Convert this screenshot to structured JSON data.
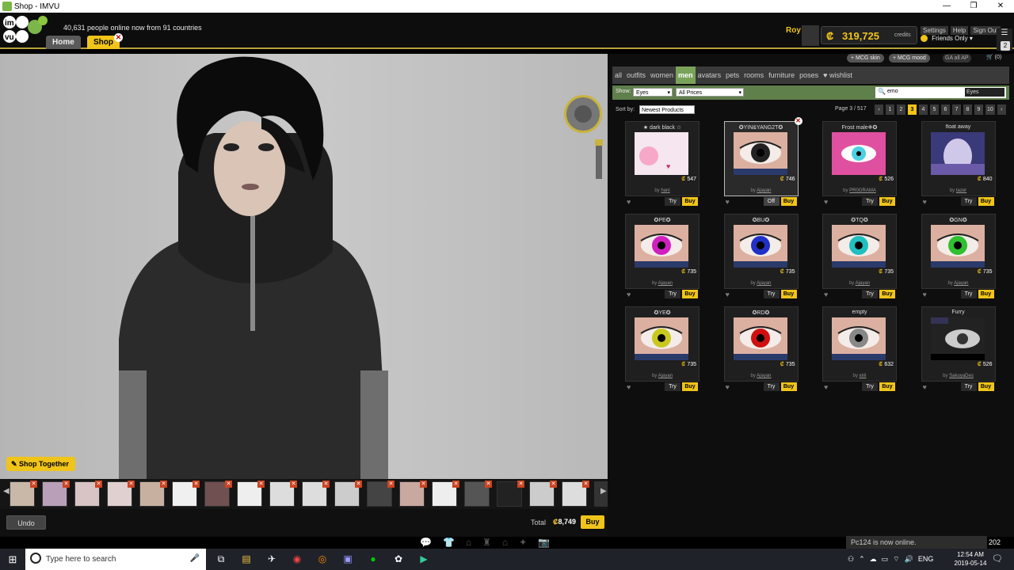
{
  "window": {
    "title": "Shop - IMVU",
    "controls": [
      "—",
      "❐",
      "✕"
    ]
  },
  "header": {
    "online_text": "40,631 people online now from 91 countries",
    "tabs": {
      "home": "Home",
      "shop": "Shop",
      "close": "✕"
    },
    "user_name": "Roy",
    "credits_icon": "₡",
    "credits_value": "319,725",
    "credits_label": "credits",
    "links": {
      "settings": "Settings",
      "help": "Help",
      "signout": "Sign Out"
    },
    "visibility": "Friends Only",
    "menu_badge": "2"
  },
  "viewport": {
    "shop_together": "Shop Together"
  },
  "shop": {
    "mcg_skin": "+ MCG skin",
    "mcg_mood": "+ MCG mood",
    "rating_filter": "GA all AP",
    "cart": "(0)",
    "categories": [
      "all",
      "outfits",
      "women",
      "men",
      "avatars",
      "pets",
      "rooms",
      "furniture",
      "poses",
      "wishlist"
    ],
    "show_label": "Show:",
    "show_value": "Eyes",
    "price_value": "All Prices",
    "search_value": "emo",
    "search_type": "Eyes",
    "sort_label": "Sort by:",
    "sort_value": "Newest Products",
    "page_info": "Page 3 / 517",
    "pager": [
      "‹",
      "1",
      "2",
      "3",
      "4",
      "5",
      "6",
      "7",
      "8",
      "9",
      "10",
      "›"
    ],
    "try_label": "Try",
    "buy_label": "Buy",
    "by_prefix": "by",
    "products": [
      {
        "name": "★ dark black ☆",
        "price": "547",
        "creator": "hani",
        "buy_label": "Buy"
      },
      {
        "name": "✪YIN&YANG2T✪",
        "price": "746",
        "creator": "Ajayan",
        "buy_label": "Buy"
      },
      {
        "name": "Frost male❄✪",
        "price": "526",
        "creator": "PR0GRAMA",
        "buy_label": "Buy"
      },
      {
        "name": "float away",
        "price": "840",
        "creator": "tazer",
        "buy_label": "Buy"
      },
      {
        "name": "✪PE✪",
        "price": "735",
        "creator": "Ajayan",
        "buy_label": "Buy"
      },
      {
        "name": "✪BU✪",
        "price": "735",
        "creator": "Ajayan",
        "buy_label": "Buy"
      },
      {
        "name": "✪TQ✪",
        "price": "735",
        "creator": "Ajayan",
        "buy_label": "Buy"
      },
      {
        "name": "✪GN✪",
        "price": "735",
        "creator": "Ajayan",
        "buy_label": "Buy"
      },
      {
        "name": "✪YE✪",
        "price": "735",
        "creator": "Ajayan",
        "buy_label": "Buy"
      },
      {
        "name": "✪RD✪",
        "price": "735",
        "creator": "Ajayan",
        "buy_label": "Buy"
      },
      {
        "name": "empty",
        "price": "632",
        "creator": "xirii",
        "buy_label": "Buy"
      },
      {
        "name": "Furry",
        "price": "526",
        "creator": "SakuyaDes",
        "buy_label": "Buy"
      }
    ],
    "selected_card_button": "Off"
  },
  "bottom": {
    "undo": "Undo",
    "total_label": "Total",
    "total_value": "8,749",
    "buy": "Buy"
  },
  "notification": {
    "text": "Pc124 is now online.",
    "count": "202"
  },
  "taskbar": {
    "search_placeholder": "Type here to search",
    "lang": "ENG",
    "time": "12:54 AM",
    "date": "2019-05-14"
  },
  "colors": {
    "accent": "#f0c419",
    "category_active": "#7aa35a",
    "filter_bar": "#5f7f4b"
  }
}
